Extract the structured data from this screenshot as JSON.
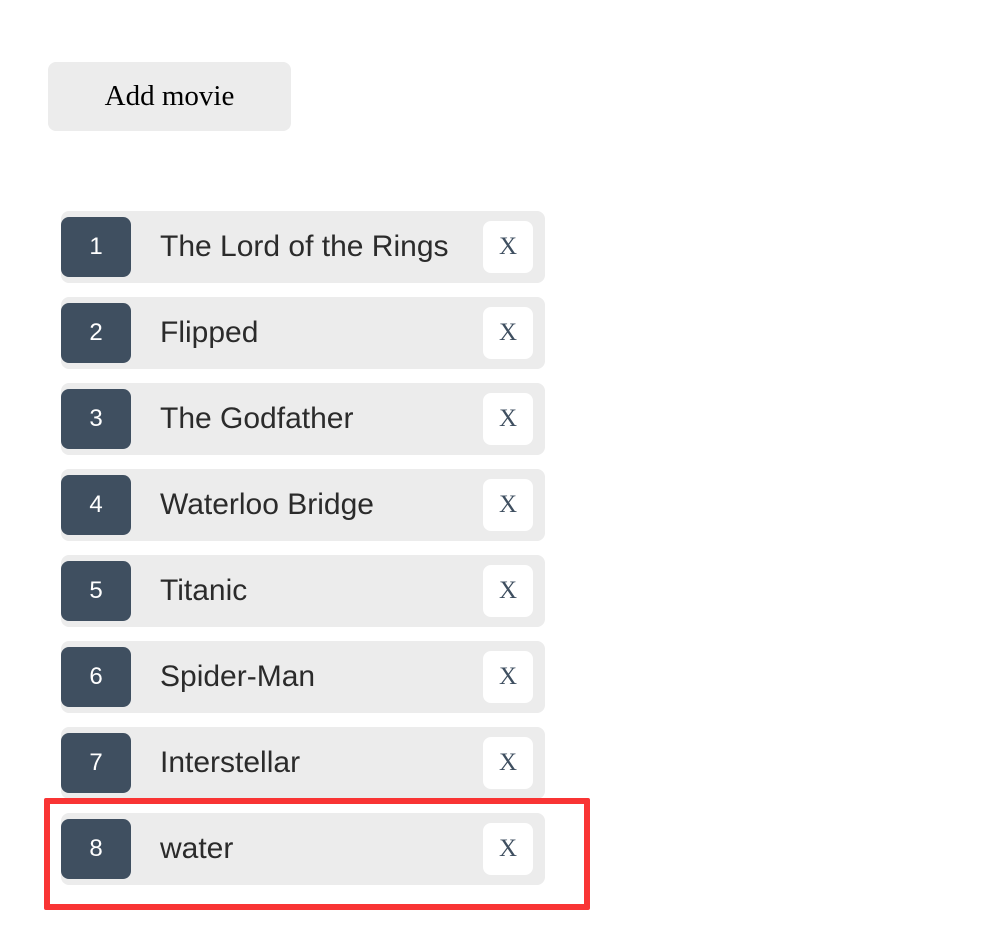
{
  "colors": {
    "page_background": "#ffffff",
    "button_background": "#ececec",
    "row_background": "#ececec",
    "badge_background": "#3f4f60",
    "badge_text": "#ffffff",
    "title_text": "#2b2b2b",
    "remove_button_background": "#ffffff",
    "remove_button_text": "#3f4f60",
    "annotation_outline": "#f93434"
  },
  "toolbar": {
    "add_movie_label": "Add movie"
  },
  "movie_list": {
    "remove_label": "X",
    "items": [
      {
        "rank": "1",
        "title": "The Lord of the Rings"
      },
      {
        "rank": "2",
        "title": "Flipped"
      },
      {
        "rank": "3",
        "title": "The Godfather"
      },
      {
        "rank": "4",
        "title": "Waterloo Bridge"
      },
      {
        "rank": "5",
        "title": "Titanic"
      },
      {
        "rank": "6",
        "title": "Spider-Man"
      },
      {
        "rank": "7",
        "title": "Interstellar"
      },
      {
        "rank": "8",
        "title": "water"
      }
    ]
  },
  "annotation": {
    "highlighted_rank": "8",
    "highlighted_title": "water"
  }
}
